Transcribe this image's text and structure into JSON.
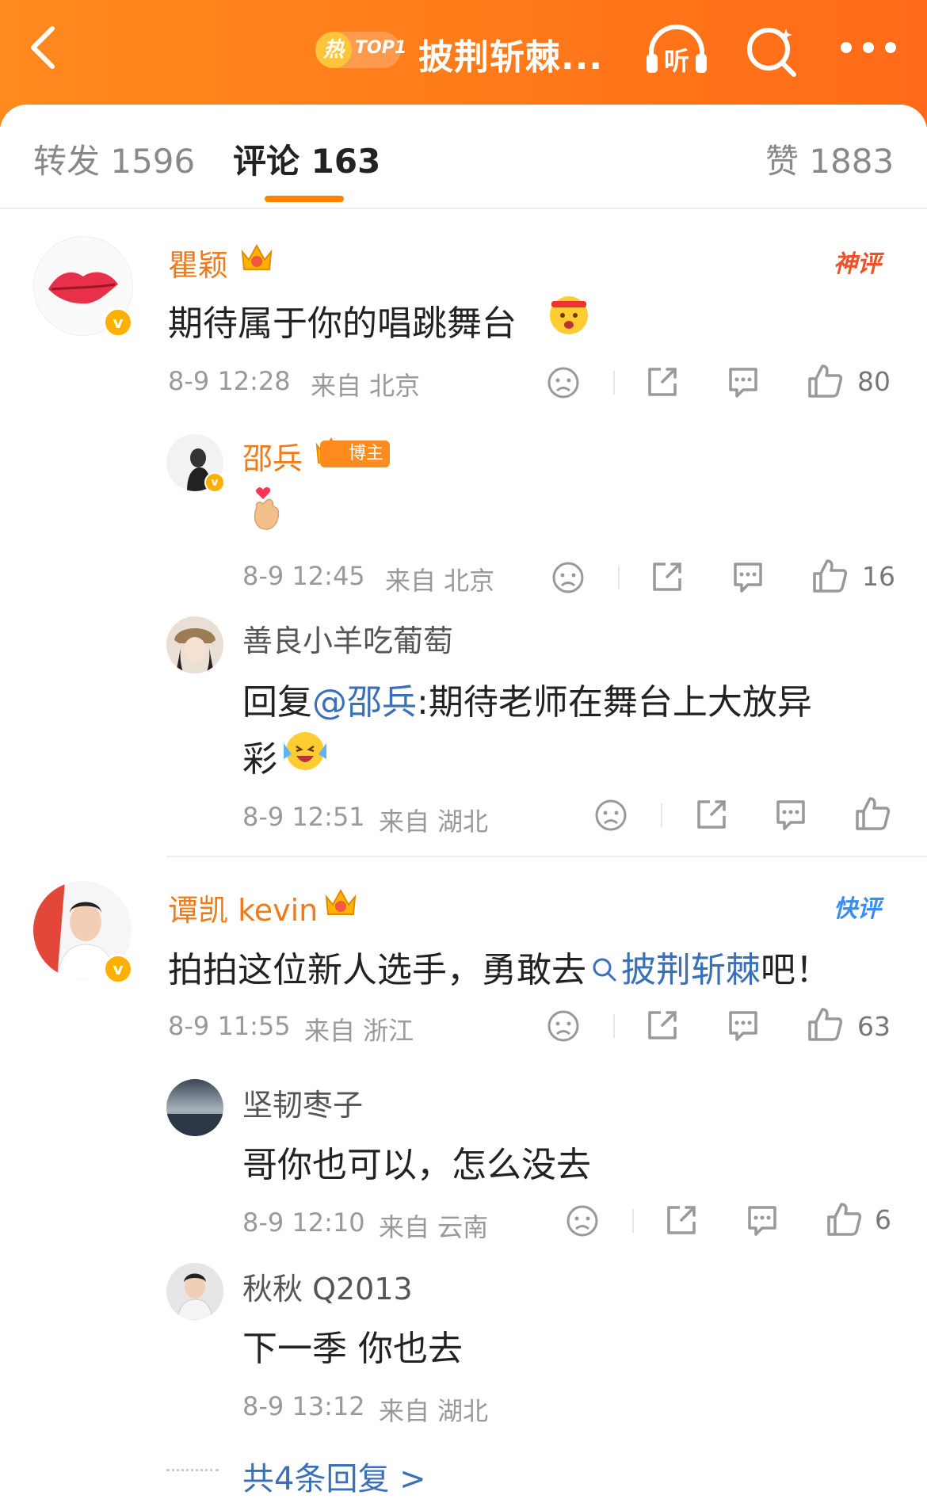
{
  "header": {
    "hot_label": "热",
    "top_label": "TOP1",
    "title": "披荆斩棘...",
    "listen_label": "听",
    "icons": [
      "back-arrow-icon",
      "headphones-icon",
      "search-icon",
      "more-icon"
    ]
  },
  "tabs": {
    "repost": "转发 1596",
    "comments": "评论 163",
    "likes": "赞 1883"
  },
  "comments": [
    {
      "name": "瞿颖",
      "badge_label": "神评",
      "text": "期待属于你的唱跳舞台",
      "time": "8-9 12:28",
      "source": "来自 北京",
      "likes": "80",
      "replies": [
        {
          "name": "邵兵",
          "tag": "博主",
          "text": "",
          "time": "8-9 12:45",
          "source": "来自 北京",
          "likes": "16"
        },
        {
          "name": "善良小羊吃葡萄",
          "reply_prefix": "回复",
          "mention": "@邵兵",
          "text_line1": ":期待老师在舞台上大放异",
          "text_line2": "彩",
          "time": "8-9 12:51",
          "source": "来自 湖北",
          "likes": ""
        }
      ]
    },
    {
      "name": "谭凯 kevin",
      "badge_label": "快评",
      "text_before": "拍拍这位新人选手，勇敢去",
      "topic": "披荆斩棘",
      "text_after": "吧！",
      "time": "8-9 11:55",
      "source": "来自 浙江",
      "likes": "63",
      "replies": [
        {
          "name": "坚韧枣子",
          "text": "哥你也可以，怎么没去",
          "time": "8-9 12:10",
          "source": "来自 云南",
          "likes": "6"
        },
        {
          "name": "秋秋 Q2013",
          "text": "下一季 你也去",
          "time": "8-9 13:12",
          "source": "来自 湖北",
          "likes": ""
        }
      ],
      "more_replies": "共4条回复 >"
    }
  ],
  "colors": {
    "header_orange": "#ff7a1a",
    "username_orange": "#f07b1a",
    "link_blue": "#3b6fb6",
    "verified_gold": "#ffb000"
  }
}
